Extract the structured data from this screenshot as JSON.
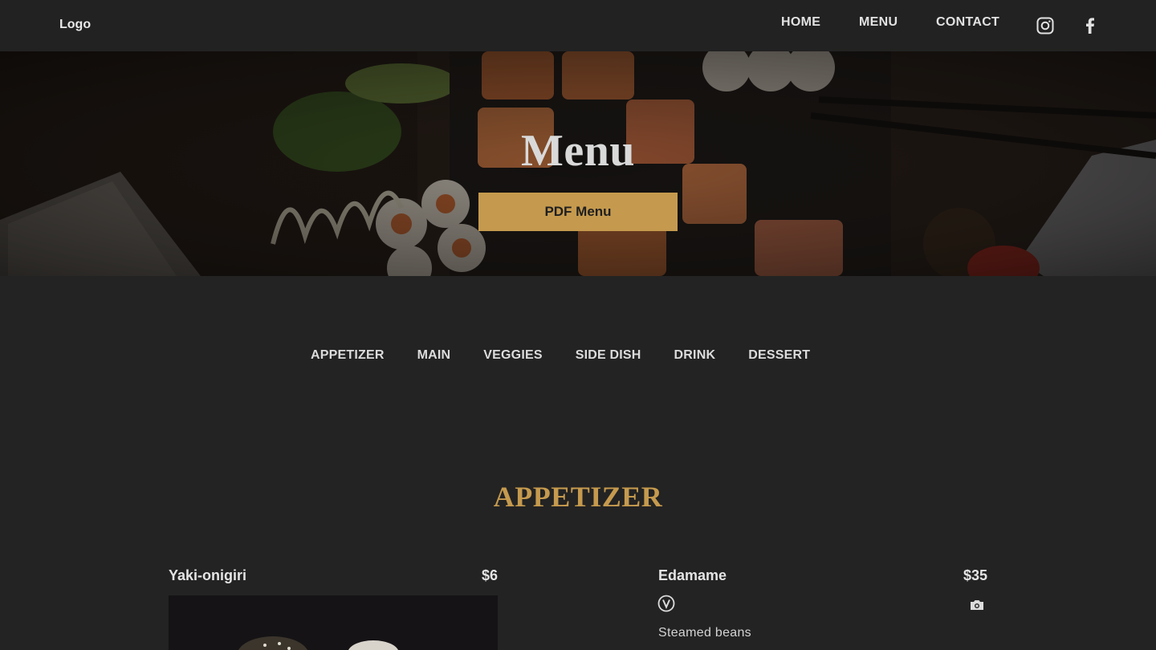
{
  "header": {
    "logo": "Logo",
    "nav": {
      "home": "HOME",
      "menu": "MENU",
      "contact": "CONTACT"
    },
    "social": [
      "instagram-icon",
      "facebook-icon"
    ]
  },
  "hero": {
    "title": "Menu",
    "pdf_button": "PDF Menu"
  },
  "categories": [
    "APPETIZER",
    "MAIN",
    "VEGGIES",
    "SIDE DISH",
    "DRINK",
    "DESSERT"
  ],
  "section": {
    "title": "APPETIZER",
    "items": [
      {
        "name": "Yaki-onigiri",
        "price": "$6",
        "icons": [
          "photo"
        ]
      },
      {
        "name": "Edamame",
        "price": "$35",
        "description": "Steamed beans",
        "icons": [
          "vegan-icon",
          "camera-icon"
        ]
      }
    ]
  },
  "colors": {
    "background": "#232323",
    "header": "#222222",
    "accent": "#c59a4e",
    "text": "#e4e4e4"
  }
}
